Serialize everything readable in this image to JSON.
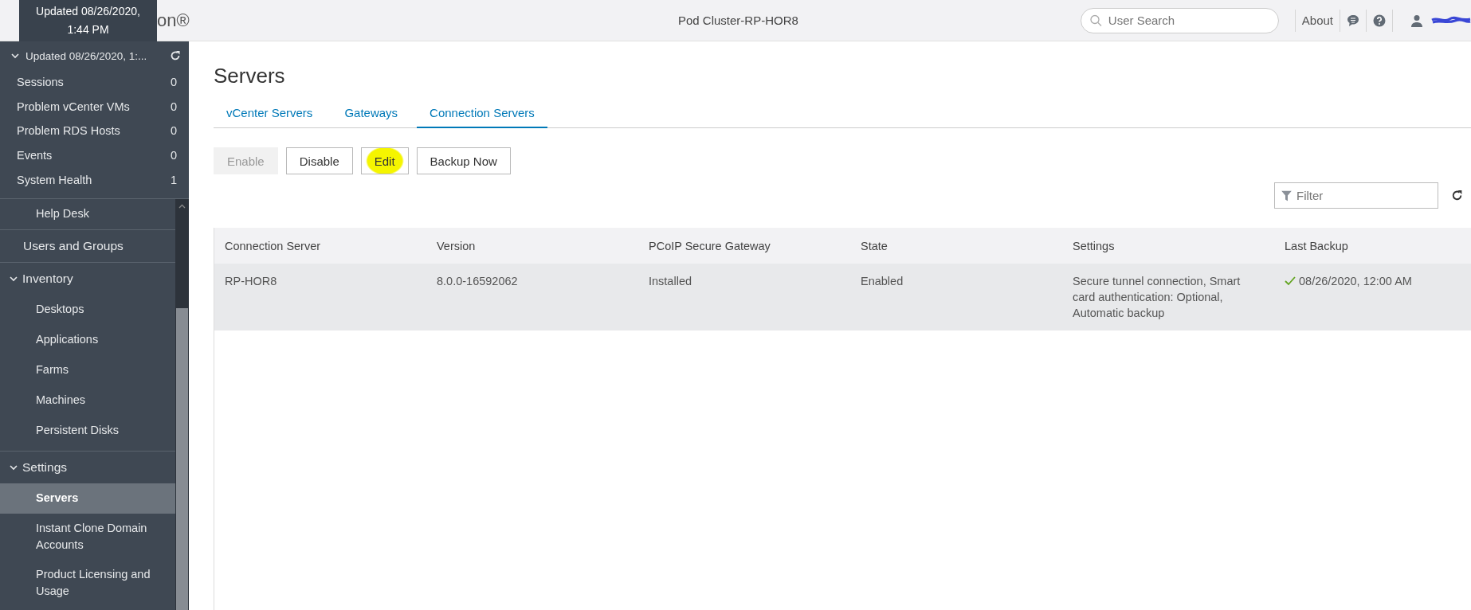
{
  "header": {
    "logo_text": "on®",
    "title": "Pod Cluster-RP-HOR8",
    "search": {
      "placeholder": "User Search"
    },
    "links": [
      {
        "label": "About"
      }
    ]
  },
  "tooltip": {
    "text": "Updated 08/26/2020, 1:44 PM"
  },
  "sidebar": {
    "summary": {
      "label": "Updated 08/26/2020, 1:...",
      "expanded": true,
      "items": [
        {
          "label": "Sessions",
          "count": "0"
        },
        {
          "label": "Problem vCenter VMs",
          "count": "0"
        },
        {
          "label": "Problem RDS Hosts",
          "count": "0"
        },
        {
          "label": "Events",
          "count": "0"
        },
        {
          "label": "System Health",
          "count": "1"
        }
      ]
    },
    "nav": [
      {
        "kind": "child",
        "label": "Help Desk",
        "selected": false
      },
      {
        "kind": "top",
        "label": "Users and Groups",
        "selected": false
      },
      {
        "kind": "group",
        "label": "Inventory",
        "expanded": true,
        "children": [
          {
            "label": "Desktops",
            "selected": false
          },
          {
            "label": "Applications",
            "selected": false
          },
          {
            "label": "Farms",
            "selected": false
          },
          {
            "label": "Machines",
            "selected": false
          },
          {
            "label": "Persistent Disks",
            "selected": false
          }
        ]
      },
      {
        "kind": "group",
        "label": "Settings",
        "expanded": true,
        "children": [
          {
            "label": "Servers",
            "selected": true
          },
          {
            "label": "Instant Clone Domain Accounts",
            "selected": false
          },
          {
            "label": "Product Licensing and Usage",
            "selected": false
          }
        ]
      }
    ]
  },
  "page": {
    "title": "Servers",
    "tabs": [
      {
        "label": "vCenter Servers",
        "selected": false
      },
      {
        "label": "Gateways",
        "selected": false
      },
      {
        "label": "Connection Servers",
        "selected": true
      }
    ],
    "buttons": [
      {
        "label": "Enable",
        "disabled": true,
        "highlighted": false
      },
      {
        "label": "Disable",
        "disabled": false,
        "highlighted": false
      },
      {
        "label": "Edit",
        "disabled": false,
        "highlighted": true
      },
      {
        "label": "Backup Now",
        "disabled": false,
        "highlighted": false
      }
    ],
    "filter": {
      "placeholder": "Filter"
    },
    "table": {
      "columns": [
        "Connection Server",
        "Version",
        "PCoIP Secure Gateway",
        "State",
        "Settings",
        "Last Backup"
      ],
      "rows": [
        {
          "selected": true,
          "backup_ok": true,
          "cells": [
            "RP-HOR8",
            "8.0.0-16592062",
            "Installed",
            "Enabled",
            "Secure tunnel connection, Smart card authentication: Optional, Automatic backup",
            "08/26/2020, 12:00 AM"
          ]
        }
      ]
    }
  }
}
